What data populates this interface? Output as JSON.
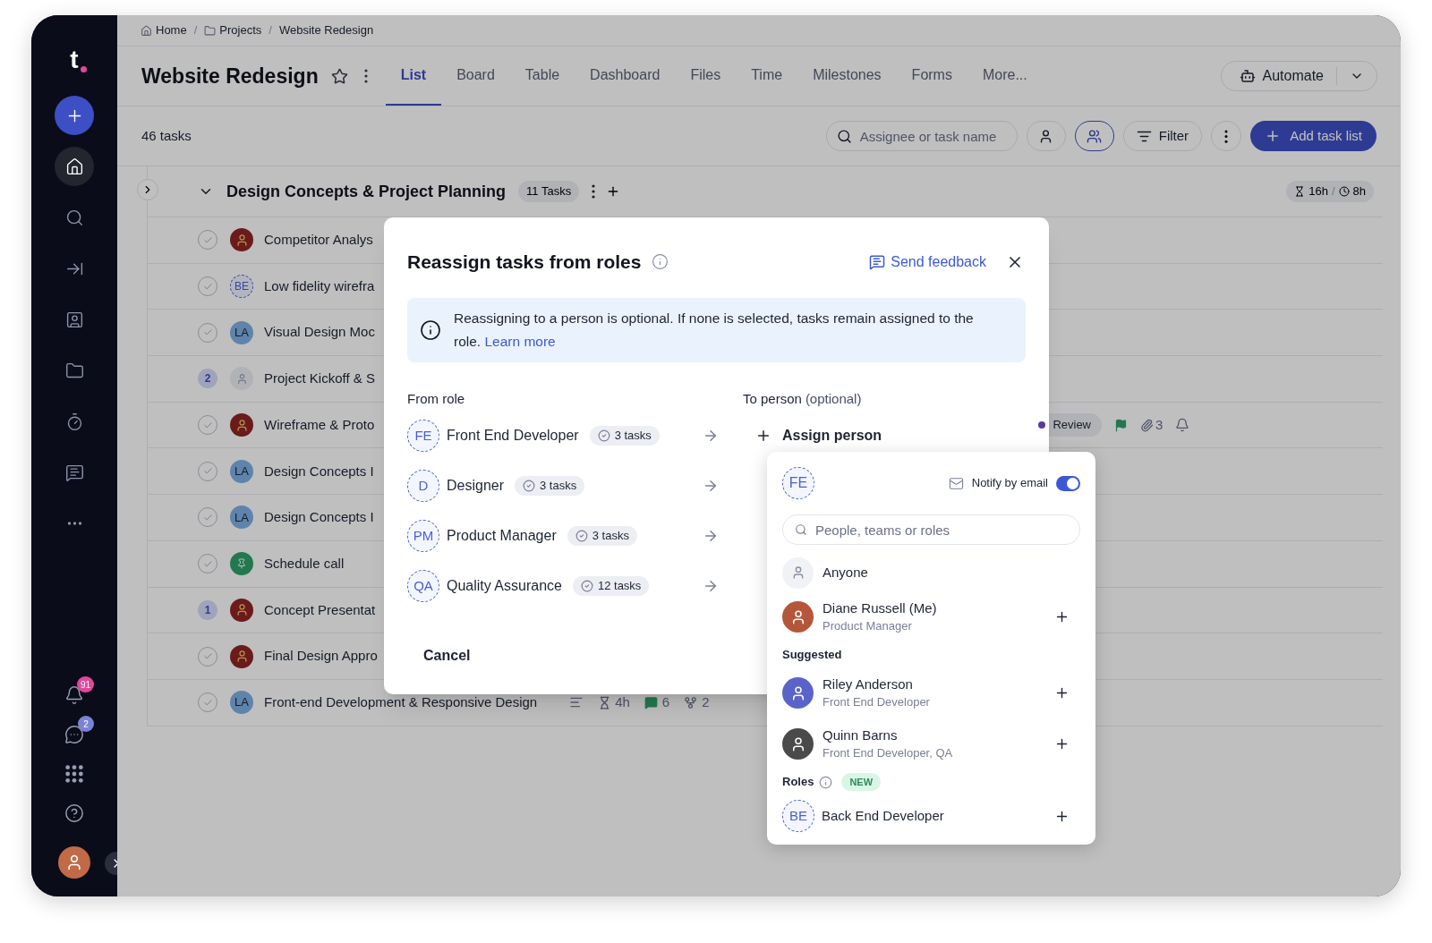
{
  "breadcrumbs": [
    {
      "label": "Home",
      "kind": "home"
    },
    {
      "label": "Projects",
      "kind": "folder",
      "separator": "/"
    },
    {
      "label": "Website Redesign",
      "kind": "page",
      "separator": "/"
    }
  ],
  "project": {
    "title": "Website Redesign",
    "starred": false
  },
  "tabs": [
    {
      "label": "List",
      "selected": true
    },
    {
      "label": "Board",
      "selected": false
    },
    {
      "label": "Table",
      "selected": false
    },
    {
      "label": "Dashboard",
      "selected": false
    },
    {
      "label": "Files",
      "selected": false
    },
    {
      "label": "Time",
      "selected": false
    },
    {
      "label": "Milestones",
      "selected": false
    },
    {
      "label": "Forms",
      "selected": false
    },
    {
      "label": "More...",
      "selected": false
    }
  ],
  "automate": "Automate",
  "toolbar": {
    "count": "46 tasks",
    "search_placeholder": "Assignee or task name",
    "views": [
      {
        "kind": "person",
        "selected": false
      },
      {
        "kind": "people",
        "selected": true
      }
    ],
    "filter": "Filter",
    "add": "Add task list"
  },
  "sidebar": {
    "logo": "t",
    "items": [
      {
        "kind": "add",
        "selected": false
      },
      {
        "kind": "home",
        "selected": true
      },
      {
        "kind": "search",
        "selected": false
      },
      {
        "kind": "collapse",
        "selected": false
      },
      {
        "kind": "people",
        "selected": false
      },
      {
        "kind": "folder",
        "selected": false
      },
      {
        "kind": "timer",
        "selected": false
      },
      {
        "kind": "chat",
        "selected": false
      },
      {
        "kind": "more",
        "selected": false
      }
    ],
    "bottom": [
      {
        "kind": "bell",
        "badge": "91",
        "color": "#e0489a"
      },
      {
        "kind": "messages",
        "badge": "2",
        "color": "#7b83d6"
      },
      {
        "kind": "apps"
      },
      {
        "kind": "help"
      }
    ]
  },
  "group": {
    "title": "Design Concepts & Project Planning",
    "expanded": true,
    "count": "11 Tasks",
    "estimate": "16h",
    "separator": "/",
    "logged": "8h"
  },
  "tasks": [
    {
      "name": "Competitor Analys",
      "marker": {
        "kind": "check",
        "done": false
      },
      "assignee": {
        "kind": "photo"
      }
    },
    {
      "name": "Low fidelity wirefra",
      "marker": {
        "kind": "check",
        "done": false
      },
      "assignee": {
        "kind": "role",
        "text": "BE"
      }
    },
    {
      "name": "Visual Design Moc",
      "marker": {
        "kind": "check",
        "done": false
      },
      "assignee": {
        "kind": "initials",
        "text": "LA"
      }
    },
    {
      "name": "Project Kickoff & S",
      "marker": {
        "kind": "count",
        "text": "2"
      },
      "assignee": {
        "kind": "unassigned"
      }
    },
    {
      "name": "Wireframe & Proto",
      "marker": {
        "kind": "check",
        "done": false
      },
      "assignee": {
        "kind": "photo"
      },
      "status": {
        "label": "Review",
        "color": "#5d3aa2"
      },
      "flag": true,
      "attachments": "3",
      "bell": true
    },
    {
      "name": "Design Concepts I",
      "marker": {
        "kind": "check",
        "done": false
      },
      "assignee": {
        "kind": "initials",
        "text": "LA"
      }
    },
    {
      "name": "Design Concepts I",
      "marker": {
        "kind": "check",
        "done": false
      },
      "assignee": {
        "kind": "initials",
        "text": "LA"
      }
    },
    {
      "name": "Schedule call",
      "marker": {
        "kind": "check",
        "done": false
      },
      "assignee": {
        "kind": "pin"
      }
    },
    {
      "name": "Concept Presentat",
      "marker": {
        "kind": "count",
        "text": "1"
      },
      "assignee": {
        "kind": "photo"
      }
    },
    {
      "name": "Final Design Appro",
      "marker": {
        "kind": "check",
        "done": false
      },
      "assignee": {
        "kind": "photo"
      }
    },
    {
      "name": "Front-end Development & Responsive Design",
      "marker": {
        "kind": "check",
        "done": false
      },
      "assignee": {
        "kind": "initials",
        "text": "LA"
      },
      "description": true,
      "estimate": "4h",
      "comments": "6",
      "subtasks": "2"
    }
  ],
  "modal": {
    "title": "Reassign tasks from roles",
    "feedback": "Send feedback",
    "notice": "Reassigning to a person is optional. If none is selected, tasks remain assigned to the role.",
    "notice_link": "Learn more",
    "from_header": "From role",
    "to_header": "To person",
    "to_hint": "(optional)",
    "roles": [
      {
        "initials": "FE",
        "name": "Front End Developer",
        "count": "3 tasks"
      },
      {
        "initials": "D",
        "name": "Designer",
        "count": "3 tasks"
      },
      {
        "initials": "PM",
        "name": "Product Manager",
        "count": "3 tasks"
      },
      {
        "initials": "QA",
        "name": "Quality Assurance",
        "count": "12 tasks"
      }
    ],
    "assign": "Assign person",
    "cancel": "Cancel"
  },
  "picker": {
    "role": "FE",
    "notify_label": "Notify by email",
    "notify": true,
    "search_placeholder": "People, teams or roles",
    "items": [
      {
        "kind": "anyone",
        "name": "Anyone"
      },
      {
        "kind": "person",
        "name": "Diane Russell (Me)",
        "detail": "Product Manager",
        "color": "#b5563a"
      },
      {
        "kind": "section",
        "name": "Suggested"
      },
      {
        "kind": "person",
        "name": "Riley Anderson",
        "detail": "Front End Developer",
        "color": "#5a64c8"
      },
      {
        "kind": "person",
        "name": "Quinn Barns",
        "detail": "Front End Developer, QA",
        "color": "#4a4a4a"
      },
      {
        "kind": "section",
        "name": "Roles",
        "info": true,
        "badge": "NEW"
      },
      {
        "kind": "role",
        "name": "Back End Developer",
        "initials": "BE"
      }
    ]
  }
}
